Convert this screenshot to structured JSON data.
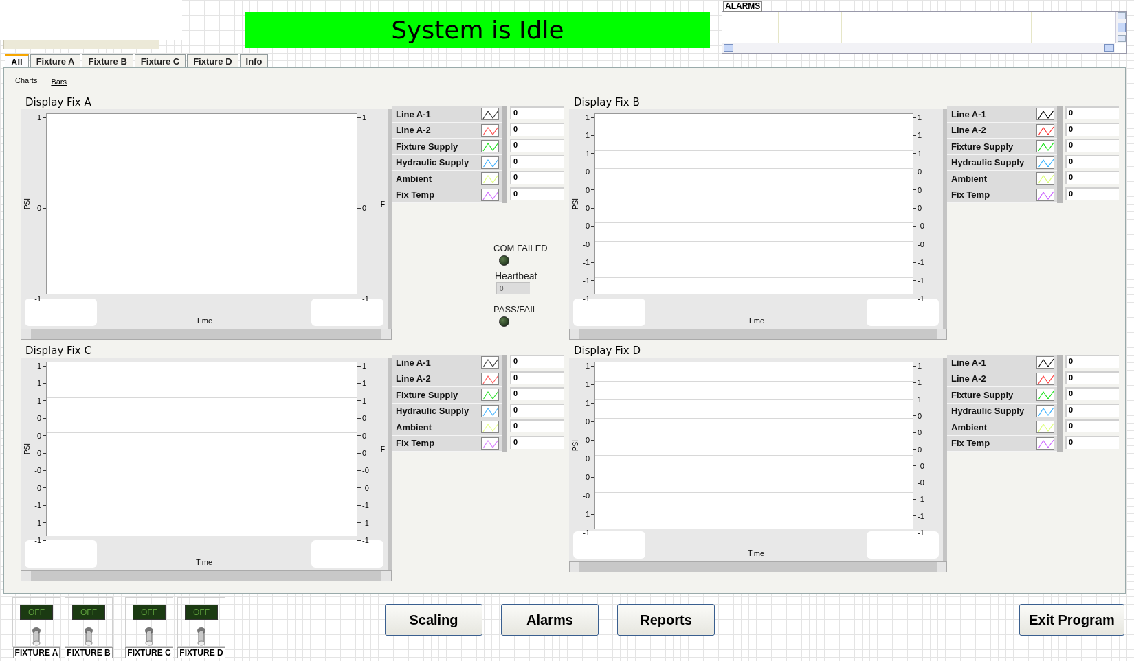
{
  "status_banner": {
    "text": "System is Idle"
  },
  "alarms": {
    "title": "ALARMS"
  },
  "tabs": [
    {
      "label": "All",
      "selected": true
    },
    {
      "label": "Fixture A",
      "selected": false
    },
    {
      "label": "Fixture B",
      "selected": false
    },
    {
      "label": "Fixture C",
      "selected": false
    },
    {
      "label": "Fixture D",
      "selected": false
    },
    {
      "label": "Info",
      "selected": false
    }
  ],
  "view_links": [
    "Charts",
    "Bars"
  ],
  "charts": [
    {
      "title": "Display Fix A",
      "y_label": "PSI",
      "right_label": "F",
      "x_label": "Time",
      "left_ticks": [
        "1",
        "0",
        "-1"
      ],
      "right_ticks": [
        "1",
        "0",
        "-1"
      ],
      "legend": [
        {
          "name": "Line A-1",
          "color": "#303030",
          "value": "0"
        },
        {
          "name": "Line A-2",
          "color": "#ff5050",
          "value": "0"
        },
        {
          "name": "Fixture Supply",
          "color": "#20e020",
          "value": "0"
        },
        {
          "name": "Hydraulic Supply",
          "color": "#40b0ff",
          "value": "0"
        },
        {
          "name": "Ambient",
          "color": "#e0ff80",
          "value": "0"
        },
        {
          "name": "Fix Temp",
          "color": "#d070ff",
          "value": "0"
        }
      ]
    },
    {
      "title": "Display Fix B",
      "y_label": "PSI",
      "x_label": "Time",
      "left_ticks": [
        "1",
        "1",
        "1",
        "0",
        "0",
        "0",
        "-0",
        "-0",
        "-1",
        "-1",
        "-1"
      ],
      "right_ticks": [
        "1",
        "1",
        "1",
        "0",
        "0",
        "0",
        "-0",
        "-0",
        "-1",
        "-1",
        "-1"
      ],
      "legend": [
        {
          "name": "Line A-1",
          "color": "#000000",
          "value": "0"
        },
        {
          "name": "Line A-2",
          "color": "#ff3030",
          "value": "0"
        },
        {
          "name": "Fixture Supply",
          "color": "#10e010",
          "value": "0"
        },
        {
          "name": "Hydraulic Supply",
          "color": "#30b0ff",
          "value": "0"
        },
        {
          "name": "Ambient",
          "color": "#d8ff70",
          "value": "0"
        },
        {
          "name": "Fix Temp",
          "color": "#c860ff",
          "value": "0"
        }
      ]
    },
    {
      "title": "Display Fix C",
      "y_label": "PSI",
      "right_label": "F",
      "x_label": "Time",
      "left_ticks": [
        "1",
        "1",
        "1",
        "0",
        "0",
        "0",
        "-0",
        "-0",
        "-1",
        "-1",
        "-1"
      ],
      "right_ticks": [
        "1",
        "1",
        "1",
        "0",
        "0",
        "0",
        "-0",
        "-0",
        "-1",
        "-1",
        "-1"
      ],
      "legend": [
        {
          "name": "Line A-1",
          "color": "#404040",
          "value": "0"
        },
        {
          "name": "Line A-2",
          "color": "#ff6060",
          "value": "0"
        },
        {
          "name": "Fixture Supply",
          "color": "#30e030",
          "value": "0"
        },
        {
          "name": "Hydraulic Supply",
          "color": "#50b8ff",
          "value": "0"
        },
        {
          "name": "Ambient",
          "color": "#e8ff90",
          "value": "0"
        },
        {
          "name": "Fix Temp",
          "color": "#d880ff",
          "value": "0"
        }
      ]
    },
    {
      "title": "Display Fix D",
      "y_label": "PSI",
      "x_label": "Time",
      "left_ticks": [
        "1",
        "1",
        "1",
        "0",
        "0",
        "0",
        "-0",
        "-0",
        "-1",
        "-1"
      ],
      "right_ticks": [
        "1",
        "1",
        "1",
        "0",
        "0",
        "0",
        "-0",
        "-0",
        "-1",
        "-1",
        "-1"
      ],
      "legend": [
        {
          "name": "Line A-1",
          "color": "#101010",
          "value": "0"
        },
        {
          "name": "Line A-2",
          "color": "#ff4040",
          "value": "0"
        },
        {
          "name": "Fixture Supply",
          "color": "#18e018",
          "value": "0"
        },
        {
          "name": "Hydraulic Supply",
          "color": "#38b0ff",
          "value": "0"
        },
        {
          "name": "Ambient",
          "color": "#dcff78",
          "value": "0"
        },
        {
          "name": "Fix Temp",
          "color": "#cc68ff",
          "value": "0"
        }
      ]
    }
  ],
  "indicators": {
    "com_failed": {
      "label": "COM FAILED",
      "on": false
    },
    "heartbeat": {
      "label": "Heartbeat",
      "value": "0"
    },
    "pass_fail": {
      "label": "PASS/FAIL",
      "on": false
    }
  },
  "fixture_switches": [
    {
      "label": "FIXTURE A",
      "indicator": "OFF",
      "on": false
    },
    {
      "label": "FIXTURE B",
      "indicator": "OFF",
      "on": false
    },
    {
      "label": "FIXTURE C",
      "indicator": "OFF",
      "on": false
    },
    {
      "label": "FIXTURE D",
      "indicator": "OFF",
      "on": false
    }
  ],
  "buttons": [
    "Scaling",
    "Alarms",
    "Reports"
  ],
  "exit_button": "Exit Program"
}
